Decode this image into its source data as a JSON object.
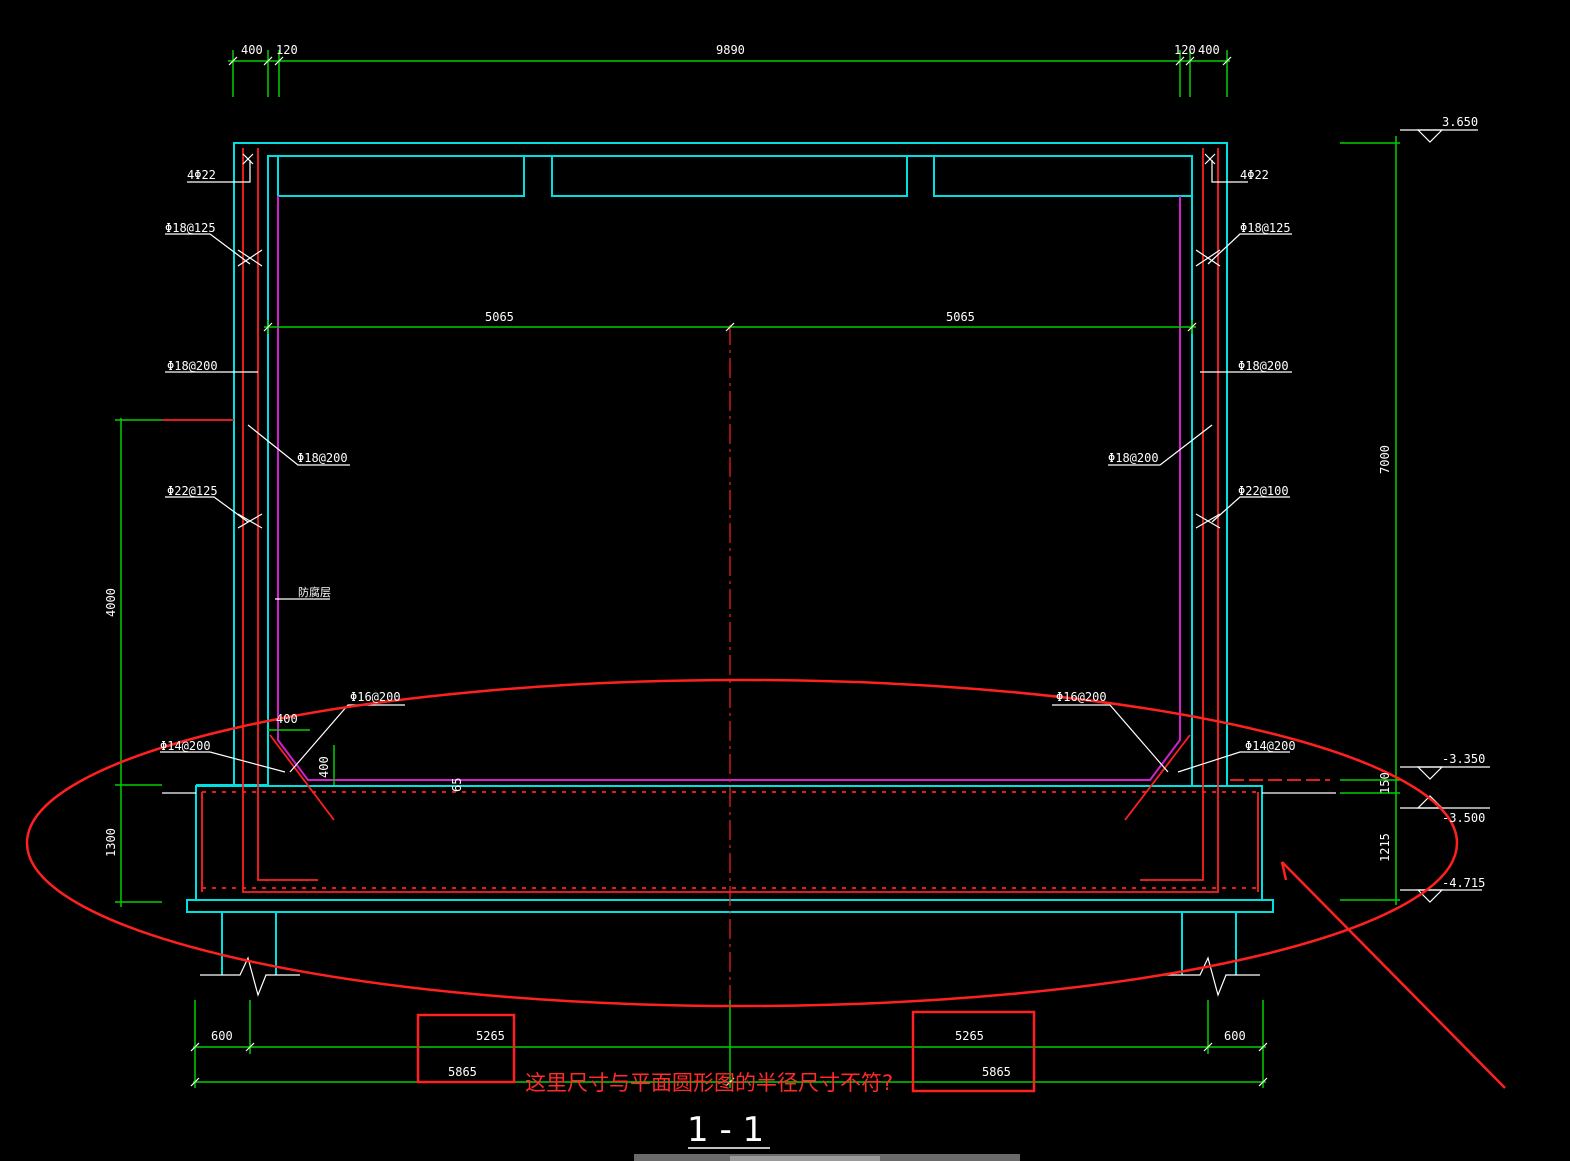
{
  "drawing": {
    "section_title": "1 - 1",
    "top_dims": {
      "left_outer": "400",
      "left_inner": "120",
      "span": "9890",
      "right_inner": "120",
      "right_outer": "400"
    },
    "mid_dims": {
      "left_half": "5065",
      "right_half": "5065"
    },
    "elevations": {
      "top": "3.650",
      "slab_top": "-3.350",
      "base_top": "-3.500",
      "bottom": "-4.715"
    },
    "vertical_dims": {
      "right_total": "7000",
      "right_150": "150",
      "right_1215": "1215",
      "left_4000": "4000",
      "left_1300": "1300",
      "haunch_v": "400",
      "haunch_h": "400",
      "gap_65": "65"
    },
    "bottom_dims": {
      "left_overhang": "600",
      "right_overhang": "600",
      "left_inner": "5265",
      "right_inner": "5265",
      "left_outer": "5865",
      "right_outer": "5865"
    },
    "rebar_left": {
      "corner": "4Φ22",
      "r1": "Φ18@125",
      "r2": "Φ18@200",
      "r3": "Φ18@200",
      "r4": "Φ22@125",
      "haunch": "Φ16@200",
      "base": "Φ14@200",
      "layer": "防腐层"
    },
    "rebar_right": {
      "corner": "4Φ22",
      "r1": "Φ18@125",
      "r2": "Φ18@200",
      "r3": "Φ18@200",
      "r4": "Φ22@100",
      "haunch": "Φ16@200",
      "base": "Φ14@200"
    },
    "annotation": "这里尺寸与平面圆形图的半径尺寸不符?"
  },
  "colors": {
    "concrete": "#00e0e0",
    "rebar": "#ff2020",
    "lining": "#d020d0",
    "dimension": "#00d000",
    "text": "#ffffff",
    "markup": "#ff2020"
  }
}
